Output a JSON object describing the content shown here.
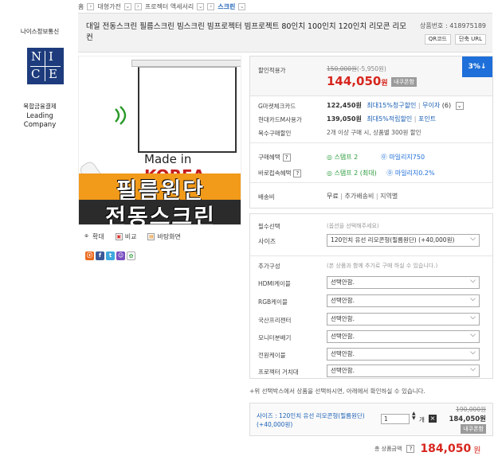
{
  "breadcrumb": {
    "home": "홈",
    "level1": "대형가전",
    "level2": "프로젝터 액세서리",
    "current": "스크린"
  },
  "product": {
    "title": "대일 전동스크린 필름스크린 빔스크린 빔프로젝터 빔프로젝트 80인치 100인치 120인치 리모콘 리모컨",
    "code": "상품번호 : 418975189",
    "qr_label": "QR코드",
    "short_url_label": "단축 URL"
  },
  "sidebar": {
    "company_name": "나이스정보통신",
    "logo_letters": [
      "N",
      "I",
      "C",
      "E"
    ],
    "tagline_line1": "복합금융결제",
    "tagline_line2": "Leading",
    "tagline_line3": "Company"
  },
  "image_banner": {
    "made_in": "Made in",
    "korea": "KOREA",
    "line1": "필름원단",
    "line2": "전동스크린"
  },
  "tools": {
    "zoom": "확대",
    "compare": "비교",
    "wallpaper": "바탕화면"
  },
  "sns": [
    "ⓢ",
    "f",
    "t",
    "☺",
    "✿"
  ],
  "pricing": {
    "discount_label": "할인적용가",
    "original_price": "150,000원",
    "discount_amount": "(-5,950원)",
    "final_price": "144,050",
    "won": "원",
    "my_price_tag": "내쿠폰함",
    "badge": "3%↓",
    "card1_label": "G마켓체크카드",
    "card1_price": "122,450원",
    "card1_benefit": "최대15%청구할인",
    "card1_interest": "무이자",
    "card1_months": "(6)",
    "card2_label": "현대카드M사용가",
    "card2_price": "139,050원",
    "card2_benefit": "최대5%적립할인",
    "card2_points": "포인트",
    "multi_label": "복수구매할인",
    "multi_text": "2개 이상 구매 시, 상품별 300원 할인"
  },
  "benefits": {
    "purchase_label": "구매혜택",
    "purchase_stamp": "스탬프 2",
    "purchase_mileage": "마일리지750",
    "direct_label": "바로접속혜택",
    "direct_stamp": "스탬프 2 (최대)",
    "direct_mileage": "마일리지0.2%",
    "shipping_label": "배송비",
    "shipping_free": "무료",
    "shipping_extra": "추가배송비",
    "shipping_region": "지역별"
  },
  "options": {
    "required_label": "필수선택",
    "required_hint": "(옵션을 선택해주세요)",
    "size_label": "사이즈",
    "size_value": "120인치 유선 리모콘형(필름원단) (+40,000원)",
    "extra_label": "추가구성",
    "extra_hint": "(본 상품과 함께 추가로 구매 하실 수 있습니다.)",
    "extras": [
      {
        "label": "HDMI케이블",
        "value": "선택안함."
      },
      {
        "label": "RGB케이블",
        "value": "선택안함."
      },
      {
        "label": "국산프리젠터",
        "value": "선택안함."
      },
      {
        "label": "모니터분배기",
        "value": "선택안함."
      },
      {
        "label": "전원케이블",
        "value": "선택안함."
      },
      {
        "label": "프로젝터 거치대",
        "value": "선택안함."
      }
    ]
  },
  "note": "+위 선택박스에서 상품을 선택하시면, 아래에서 확인하실 수 있습니다.",
  "selected": {
    "name": "사이즈 : 120인치 유선 리모콘형(필름원단) (+40,000원)",
    "qty": "1",
    "qty_unit": "개",
    "original": "190,000원",
    "price": "184,050원",
    "coupon": "내쿠폰함"
  },
  "total": {
    "label": "총 상품금액",
    "amount": "184,050",
    "won": "원"
  },
  "colors": {
    "accent_red": "#d7261e",
    "accent_blue": "#1e6fd9",
    "nice_navy": "#1e3c7d"
  }
}
